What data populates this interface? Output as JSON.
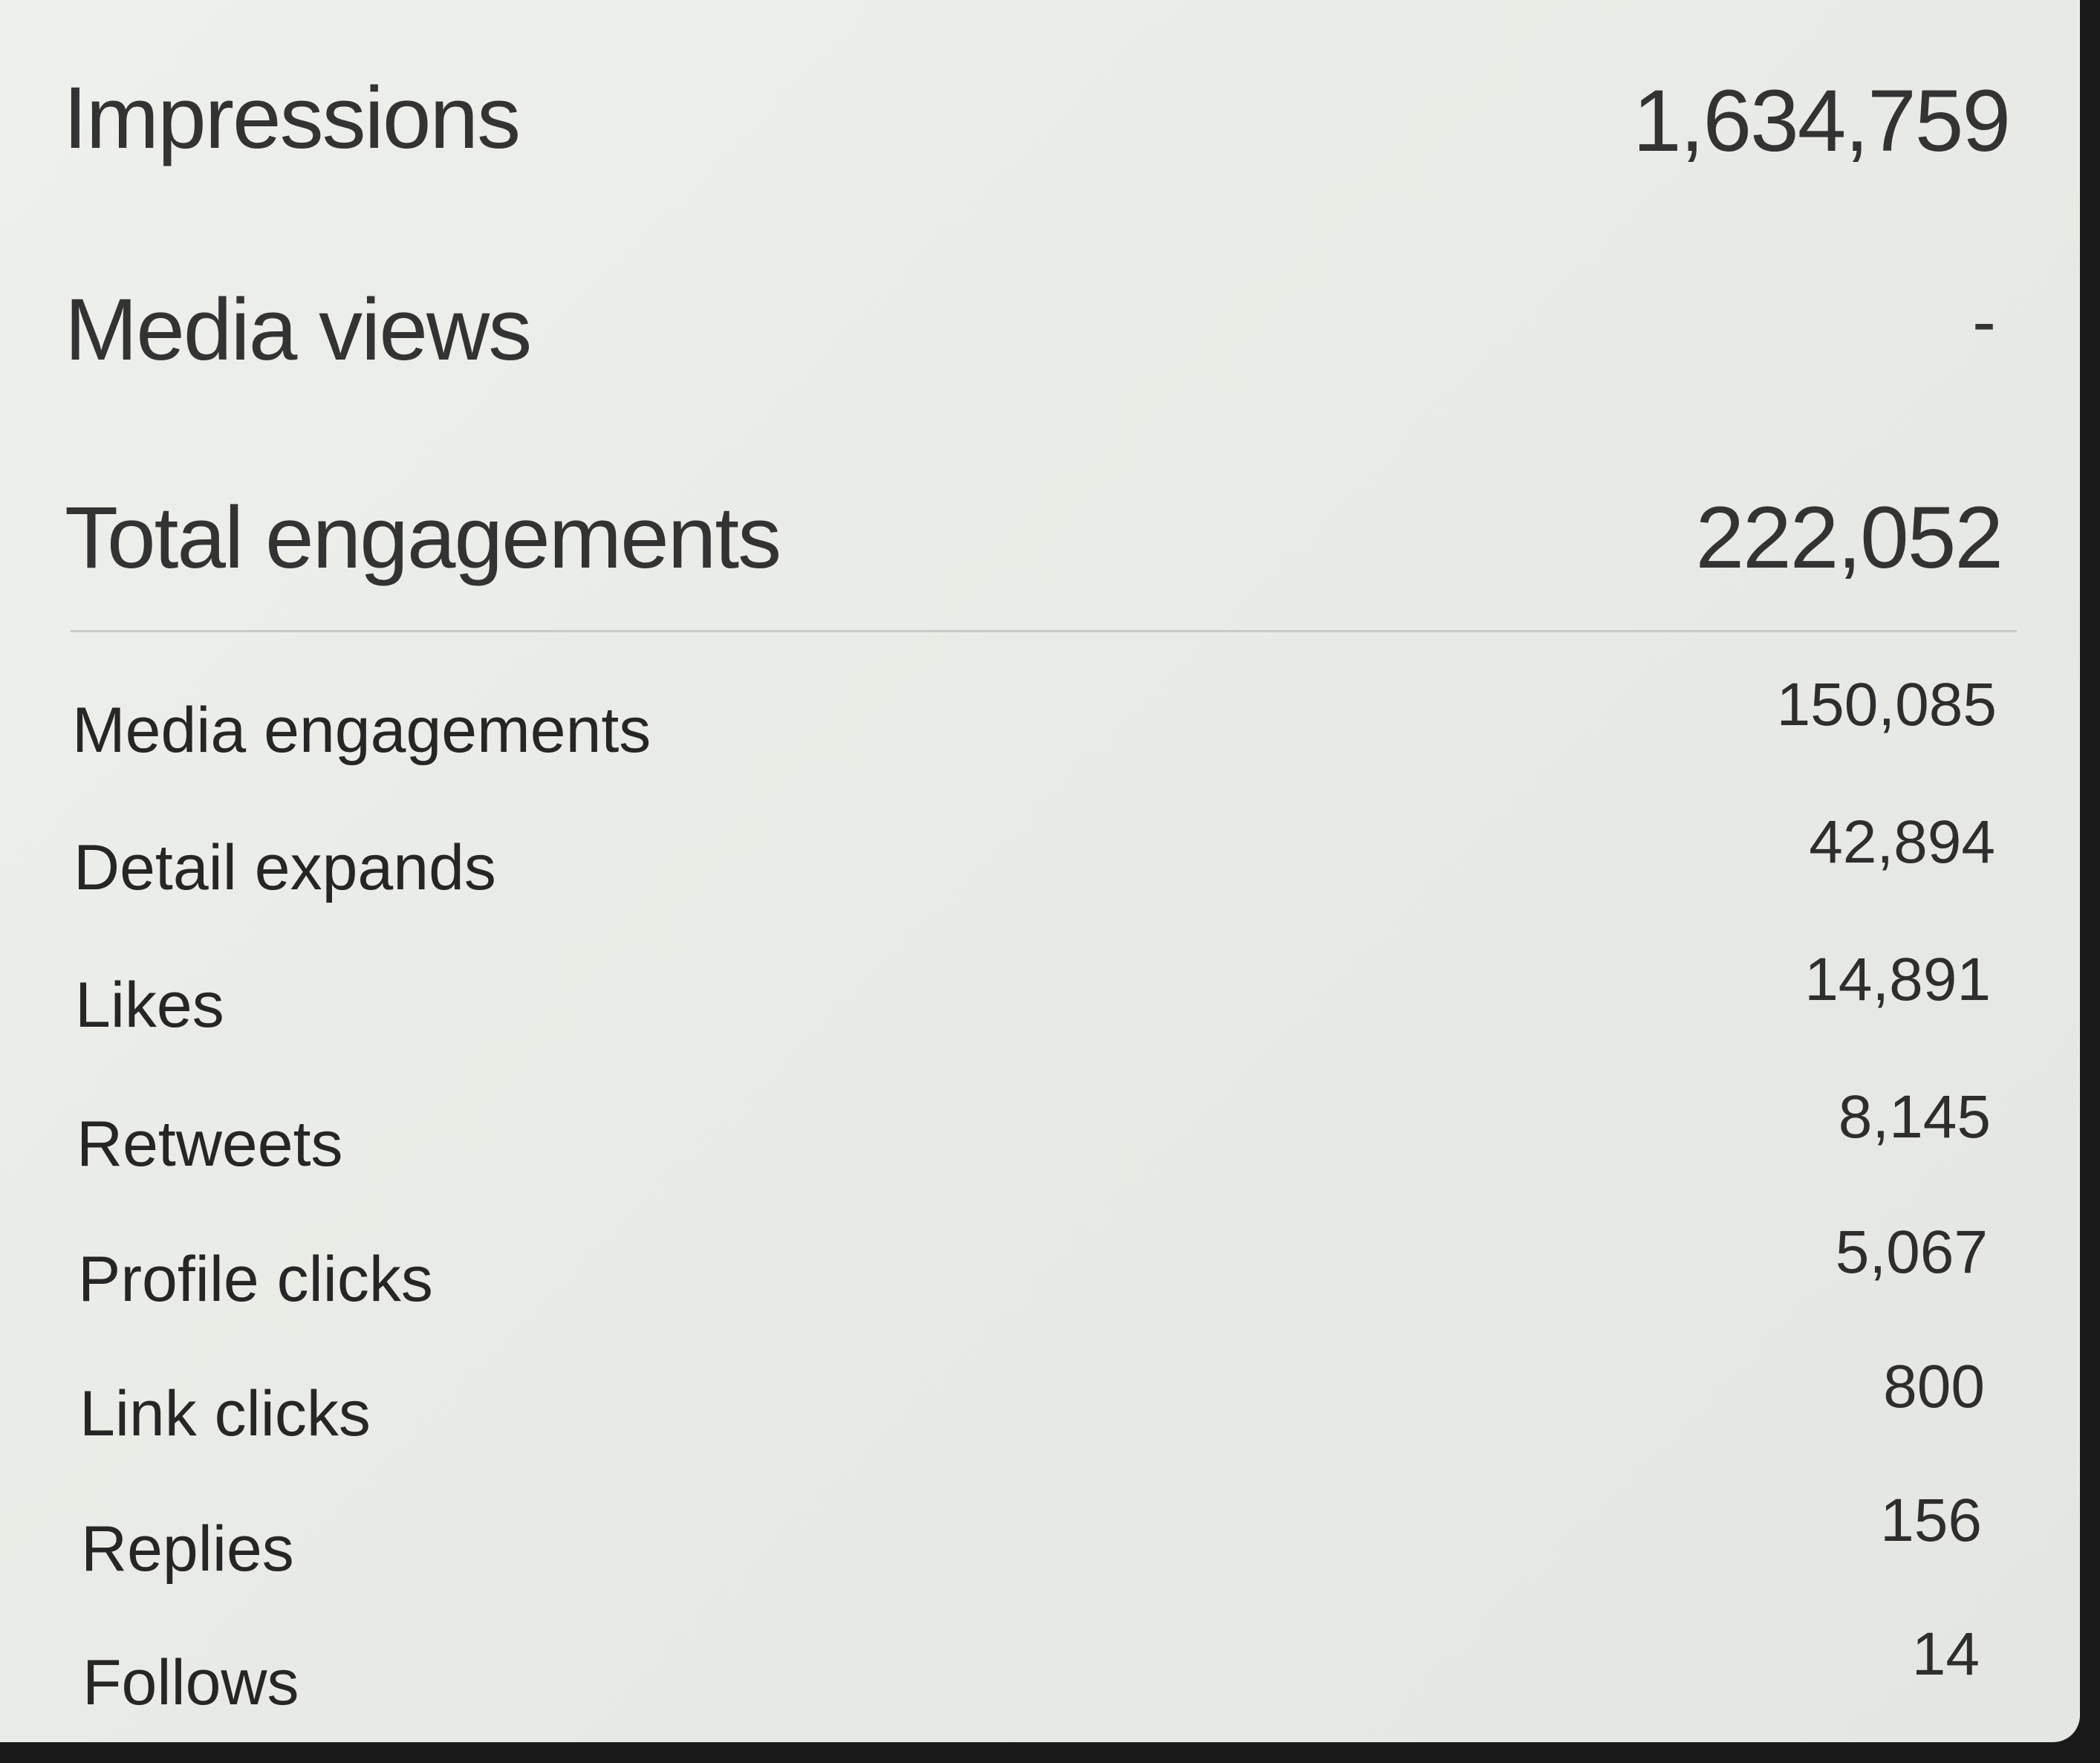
{
  "summary": [
    {
      "label": "Impressions",
      "value": "1,634,759"
    },
    {
      "label": "Media views",
      "value": "-"
    },
    {
      "label": "Total engagements",
      "value": "222,052"
    }
  ],
  "breakdown": [
    {
      "label": "Media engagements",
      "value": "150,085"
    },
    {
      "label": "Detail expands",
      "value": "42,894"
    },
    {
      "label": "Likes",
      "value": "14,891"
    },
    {
      "label": "Retweets",
      "value": "8,145"
    },
    {
      "label": "Profile clicks",
      "value": "5,067"
    },
    {
      "label": "Link clicks",
      "value": "800"
    },
    {
      "label": "Replies",
      "value": "156"
    },
    {
      "label": "Follows",
      "value": "14"
    }
  ]
}
